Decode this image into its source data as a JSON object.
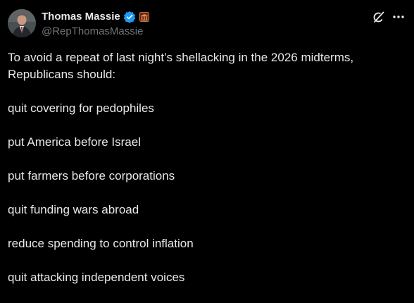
{
  "author": {
    "display_name": "Thomas Massie",
    "handle": "@RepThomasMassie",
    "verified_icon": "verified-badge-icon",
    "affiliation_icon": "congress-seal-icon"
  },
  "actions": {
    "grok_icon": "grok-icon",
    "more_icon": "more-options-icon"
  },
  "post": {
    "paragraphs": [
      "To avoid a repeat of last night’s shellacking in the 2026 midterms, Republicans should:",
      "quit covering for pedophiles",
      "put America before Israel",
      "put farmers before corporations",
      "quit funding wars abroad",
      "reduce spending to control inflation",
      "quit attacking independent voices"
    ]
  },
  "colors": {
    "background": "#000000",
    "primary_text": "#e7e9ea",
    "secondary_text": "#71767b",
    "verified_blue": "#1d9bf0"
  }
}
